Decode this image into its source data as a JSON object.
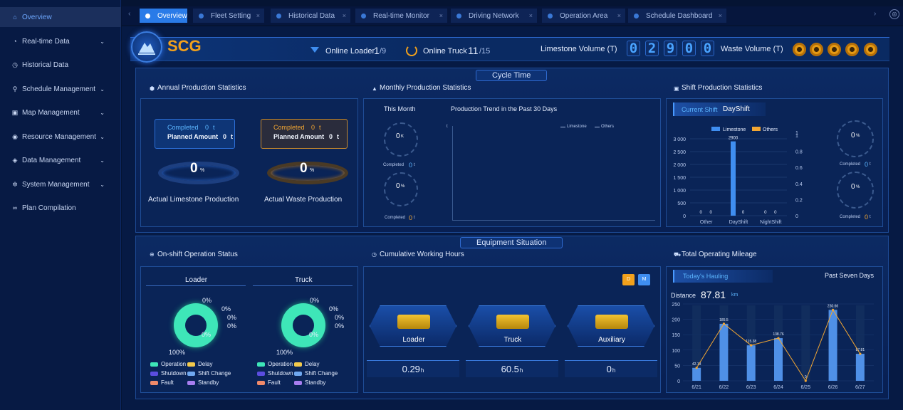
{
  "sidebar": {
    "items": [
      {
        "label": "Overview",
        "icon": "home-icon",
        "active": true,
        "has_children": false
      },
      {
        "label": "Real-time Data",
        "icon": "monitor-icon",
        "active": false,
        "has_children": true
      },
      {
        "label": "Historical Data",
        "icon": "clock-icon",
        "active": false,
        "has_children": false
      },
      {
        "label": "Schedule Management",
        "icon": "schedule-icon",
        "active": false,
        "has_children": true
      },
      {
        "label": "Map Management",
        "icon": "map-icon",
        "active": false,
        "has_children": true
      },
      {
        "label": "Resource Management",
        "icon": "resource-icon",
        "active": false,
        "has_children": true
      },
      {
        "label": "Data Management",
        "icon": "database-icon",
        "active": false,
        "has_children": true
      },
      {
        "label": "System Management",
        "icon": "gear-icon",
        "active": false,
        "has_children": true
      },
      {
        "label": "Plan Compilation",
        "icon": "link-icon",
        "active": false,
        "has_children": false
      }
    ]
  },
  "tabs": [
    {
      "label": "Overview",
      "active": true
    },
    {
      "label": "Fleet Setting",
      "active": false
    },
    {
      "label": "Historical Data",
      "active": false
    },
    {
      "label": "Real-time Monitor",
      "active": false
    },
    {
      "label": "Driving Network",
      "active": false
    },
    {
      "label": "Operation Area",
      "active": false
    },
    {
      "label": "Schedule Dashboard",
      "active": false
    }
  ],
  "header": {
    "logo_text": "SCG",
    "online_loader_label": "Online Loader",
    "online_loader_value": "1",
    "online_loader_total": "/9",
    "online_truck_label": "Online Truck",
    "online_truck_value": "11",
    "online_truck_total": "/15",
    "limestone_label": "Limestone Volume (T)",
    "limestone_digits": [
      "0",
      "2",
      "9",
      "0",
      "0"
    ],
    "waste_label": "Waste Volume (T)"
  },
  "sections": {
    "cycle_time": "Cycle Time",
    "equipment_situation": "Equipment Situation"
  },
  "annual": {
    "title": "Annual Production Statistics",
    "limestone": {
      "completed_label": "Completed",
      "completed_value": "0",
      "completed_unit": "t",
      "planned_label": "Planned Amount",
      "planned_value": "0",
      "planned_unit": "t",
      "percent": "0",
      "percent_unit": "%",
      "caption": "Actual Limestone Production"
    },
    "waste": {
      "completed_label": "Completed",
      "completed_value": "0",
      "completed_unit": "t",
      "planned_label": "Planned Amount",
      "planned_value": "0",
      "planned_unit": "t",
      "percent": "0",
      "percent_unit": "%",
      "caption": "Actual Waste Production"
    }
  },
  "monthly": {
    "title": "Monthly Production Statistics",
    "this_month": "This Month",
    "gauge1_value": "0",
    "gauge1_unit": "K",
    "completed_label": "Completed",
    "completed1_value": "0",
    "completed_unit": "t",
    "gauge2_value": "0",
    "gauge2_unit": "%",
    "completed2_value": "0",
    "trend_title": "Production Trend in the Past 30 Days",
    "trend_y_tick": "t",
    "legend_limestone": "Limestone",
    "legend_others": "Others"
  },
  "shift": {
    "title": "Shift Production Statistics",
    "current_shift_label": "Current Shift",
    "current_shift_value": "DayShift",
    "legend_limestone": "Limestone",
    "legend_others": "Others",
    "gauge1_value": "0",
    "gauge1_unit": "%",
    "completed_label": "Completed",
    "completed1_value": "0",
    "completed_unit": "t",
    "gauge2_value": "0",
    "gauge2_unit": "%",
    "completed2_value": "0"
  },
  "onshift": {
    "title": "On-shift Operation Status",
    "loader_label": "Loader",
    "truck_label": "Truck",
    "loader_pcts": [
      "0%",
      "0%",
      "0%",
      "0%",
      "0%"
    ],
    "loader_main_pct": "100%",
    "truck_pcts": [
      "0%",
      "0%",
      "0%",
      "0%",
      "0%"
    ],
    "truck_main_pct": "100%",
    "legend": [
      {
        "label": "Operation",
        "color": "#3ee6b8"
      },
      {
        "label": "Delay",
        "color": "#f2c94c"
      },
      {
        "label": "Shutdown",
        "color": "#5b4de0"
      },
      {
        "label": "Shift Change",
        "color": "#6fa8f0"
      },
      {
        "label": "Fault",
        "color": "#f08a6a"
      },
      {
        "label": "Standby",
        "color": "#a77ef0"
      }
    ]
  },
  "working_hours": {
    "title": "Cumulative Working Hours",
    "day_button": "D",
    "month_button": "M",
    "items": [
      {
        "label": "Loader",
        "value": "0.29",
        "unit": "h"
      },
      {
        "label": "Truck",
        "value": "60.5",
        "unit": "h"
      },
      {
        "label": "Auxiliary",
        "value": "0",
        "unit": "h"
      }
    ]
  },
  "mileage": {
    "title": "Total Operating Mileage",
    "todays_hauling": "Today's Hauling",
    "past_seven_days": "Past Seven Days",
    "distance_label": "Distance",
    "distance_value": "87.81",
    "distance_unit": "km"
  },
  "chart_data": [
    {
      "type": "bar",
      "title": "",
      "categories": [
        "Other",
        "DayShift",
        "NightShift"
      ],
      "series": [
        {
          "name": "Limestone",
          "values": [
            0,
            2900,
            0
          ],
          "color": "#3f8ef0"
        },
        {
          "name": "Others",
          "values": [
            0,
            0,
            0
          ],
          "color": "#f2a633"
        }
      ],
      "ylim": [
        0,
        3000
      ],
      "y_ticks": [
        "0",
        "500",
        "1 000",
        "1 500",
        "2 000",
        "2 500",
        "3 000"
      ],
      "y2_ticks": [
        "0",
        "0.2",
        "0.4",
        "0.6",
        "0.8",
        "1"
      ],
      "y2_top_label": "1",
      "data_labels": [
        "0",
        "0",
        "2900",
        "0",
        "0",
        "0"
      ]
    },
    {
      "type": "bar",
      "title": "",
      "categories": [
        "6/21",
        "6/22",
        "6/23",
        "6/24",
        "6/25",
        "6/26",
        "6/27"
      ],
      "series": [
        {
          "name": "Distance",
          "values": [
            42.13,
            185.5,
            115.38,
            138.76,
            0,
            230.66,
            87.81
          ],
          "color": "#5aa2ff"
        }
      ],
      "ylim": [
        0,
        250
      ],
      "y_ticks": [
        "0",
        "50",
        "100",
        "150",
        "200",
        "250"
      ],
      "data_labels": [
        "42.13",
        "185.5",
        "115.38",
        "138.76",
        "0",
        "230.66",
        "87.81"
      ]
    }
  ]
}
